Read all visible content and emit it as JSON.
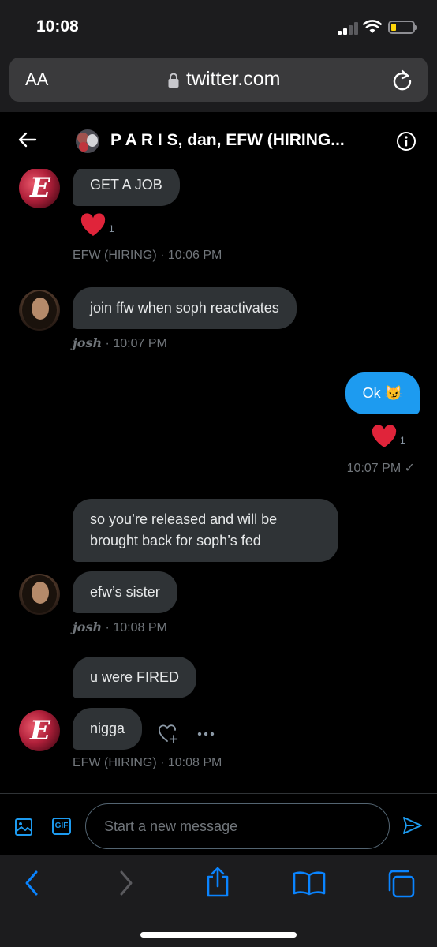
{
  "status_bar": {
    "time": "10:08"
  },
  "browser": {
    "text_size_label": "AA",
    "url": "twitter.com"
  },
  "chat": {
    "title": "P A R I S, dan, EFW (HIRING...",
    "messages": [
      {
        "text": "GET A JOB",
        "reaction_count": "1",
        "sender": "EFW (HIRING)",
        "time": "10:06 PM"
      },
      {
        "text": "join ffw when soph reactivates",
        "sender": "josh",
        "time": "10:07 PM"
      },
      {
        "text": "Ok 😼",
        "reaction_count": "1",
        "time": "10:07 PM",
        "status": "✓"
      },
      {
        "text": "so you’re released and will be brought back for soph’s fed"
      },
      {
        "text": "efw’s sister",
        "sender": "josh",
        "time": "10:08 PM"
      },
      {
        "text": "u were FIRED"
      },
      {
        "text": "nigga",
        "sender": "EFW (HIRING)",
        "time": "10:08 PM"
      }
    ]
  },
  "composer": {
    "gif_label": "GIF",
    "placeholder": "Start a new message"
  },
  "colors": {
    "accent": "#1d9bf0",
    "bubble_in": "#2f3336",
    "heart": "#f91880"
  }
}
